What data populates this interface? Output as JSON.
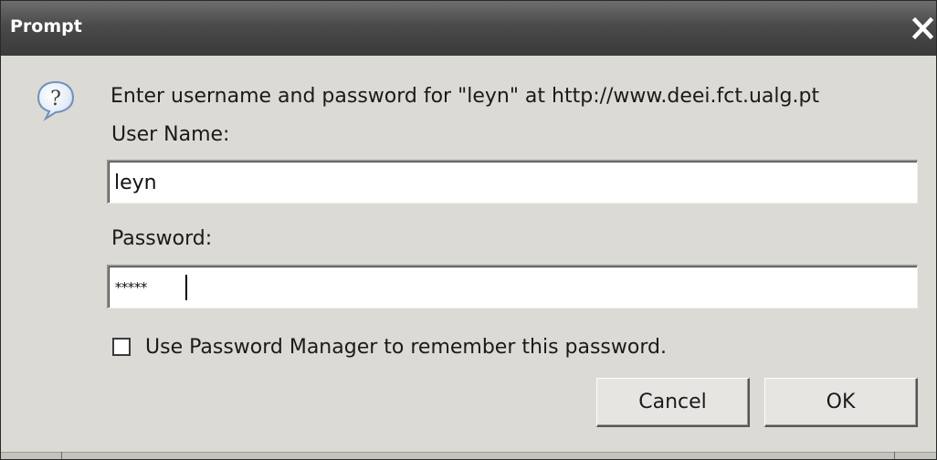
{
  "window": {
    "title": "Prompt",
    "close_icon": "close-icon"
  },
  "dialog": {
    "icon": "question-icon",
    "message": "Enter username and password for \"leyn\" at http://www.deei.fct.ualg.pt",
    "username_label": "User Name:",
    "username_value": "leyn",
    "password_label": "Password:",
    "password_mask": "*****",
    "remember_label": "Use Password Manager to remember this password.",
    "remember_checked": false
  },
  "buttons": {
    "cancel_label": "Cancel",
    "ok_label": "OK"
  }
}
